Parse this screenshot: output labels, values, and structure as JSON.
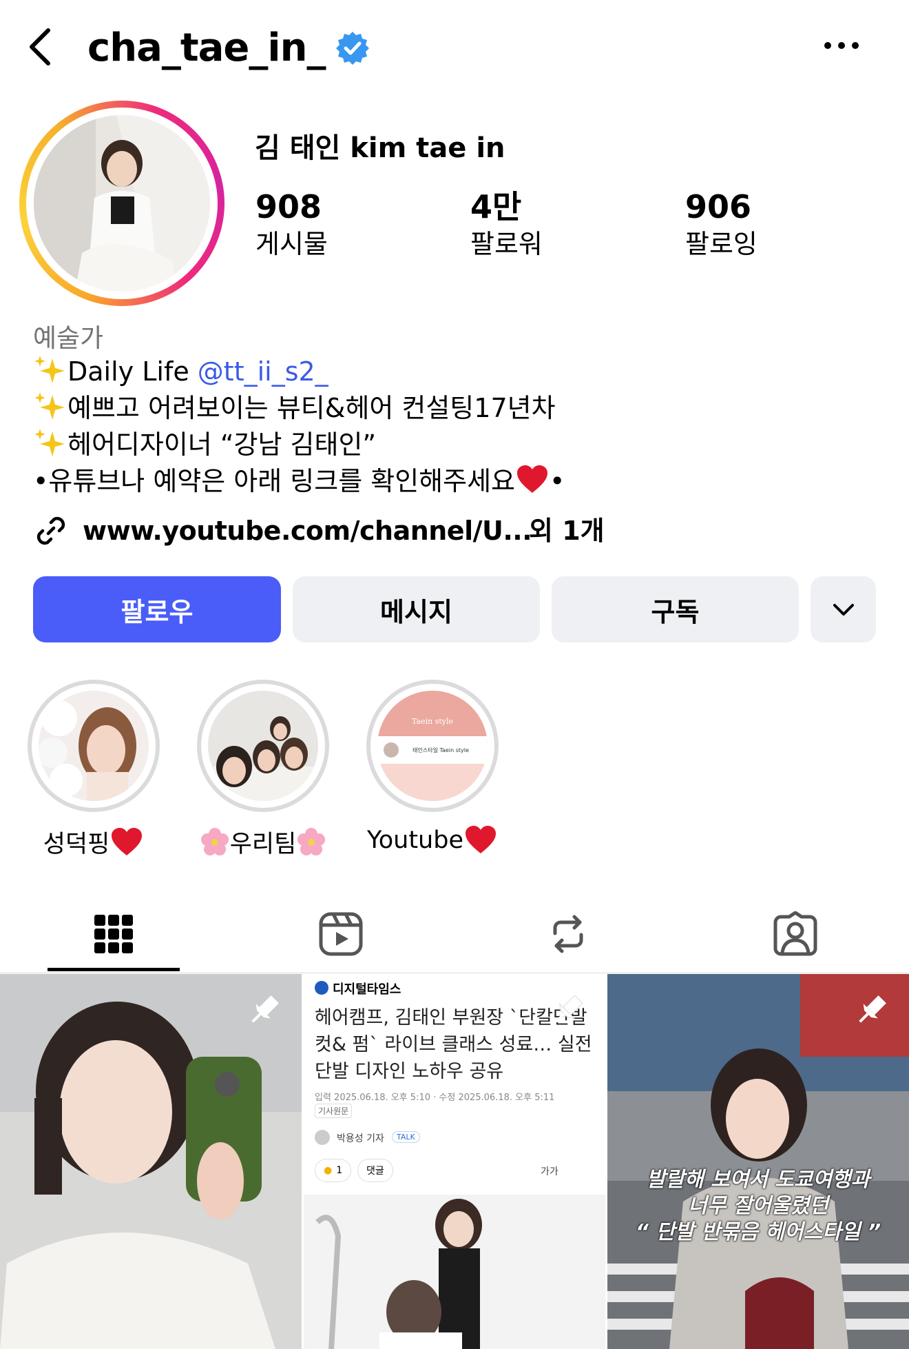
{
  "header": {
    "username": "cha_tae_in_",
    "verified": true
  },
  "profile": {
    "display_name": "김 태인 kim tae in",
    "stats": [
      {
        "value": "908",
        "label": "게시물"
      },
      {
        "value": "4만",
        "label": "팔로워"
      },
      {
        "value": "906",
        "label": "팔로잉"
      }
    ],
    "category": "예술가",
    "bio": {
      "line1_text": "Daily Life ",
      "line1_mention": "@tt_ii_s2_",
      "line2": "예쁘고 어려보이는 뷰티&헤어 컨설팅17년차",
      "line3": "헤어디자이너 “강남 김태인”",
      "line4_start": "•유튜브나 예약은 아래 링크를 확인해주세요",
      "line4_end": "•"
    },
    "link": {
      "url": "www.youtube.com/channel/U...",
      "extra": "외 1개"
    }
  },
  "actions": {
    "follow": "팔로우",
    "message": "메시지",
    "subscribe": "구독"
  },
  "highlights": [
    {
      "label": "성덕핑",
      "suffix_icon": "heart-emoji"
    },
    {
      "label": "우리팀",
      "prefix_icon": "cherry-blossom-emoji",
      "suffix_icon": "cherry-blossom-emoji"
    },
    {
      "label": "Youtube",
      "suffix_icon": "heart-emoji",
      "image_title": "Taein style",
      "image_caption": "태인스타일 Taein style"
    }
  ],
  "tabs": [
    {
      "name": "grid",
      "icon": "grid-icon",
      "active": true
    },
    {
      "name": "reels",
      "icon": "reels-icon",
      "active": false
    },
    {
      "name": "reposts",
      "icon": "repost-icon",
      "active": false
    },
    {
      "name": "tagged",
      "icon": "tagged-icon",
      "active": false
    }
  ],
  "posts": {
    "article": {
      "source": "디지털타임스",
      "headline": "헤어캠프, 김태인 부원장 `단칼단발 컷& 펌` 라이브 클래스 성료… 실전 단발 디자인 노하우 공유",
      "meta": "입력 2025.06.18. 오후 5:10 · 수정 2025.06.18. 오후 5:11",
      "original": "기사원문",
      "reporter": "박용성 기자",
      "talk": "TALK",
      "likes": "1",
      "comment": "댓글",
      "font_size": "가가"
    },
    "overlay_caption": {
      "line1": "발랄해 보여서 도쿄여행과",
      "line2": "너무 잘어울렸던",
      "line3": "“ 단발 반묶음 헤어스타일 ”"
    }
  },
  "colors": {
    "follow_button": "#4a5df9",
    "secondary_button": "#eef0f3",
    "mention": "#3a5be6",
    "verified": "#3897f0"
  }
}
